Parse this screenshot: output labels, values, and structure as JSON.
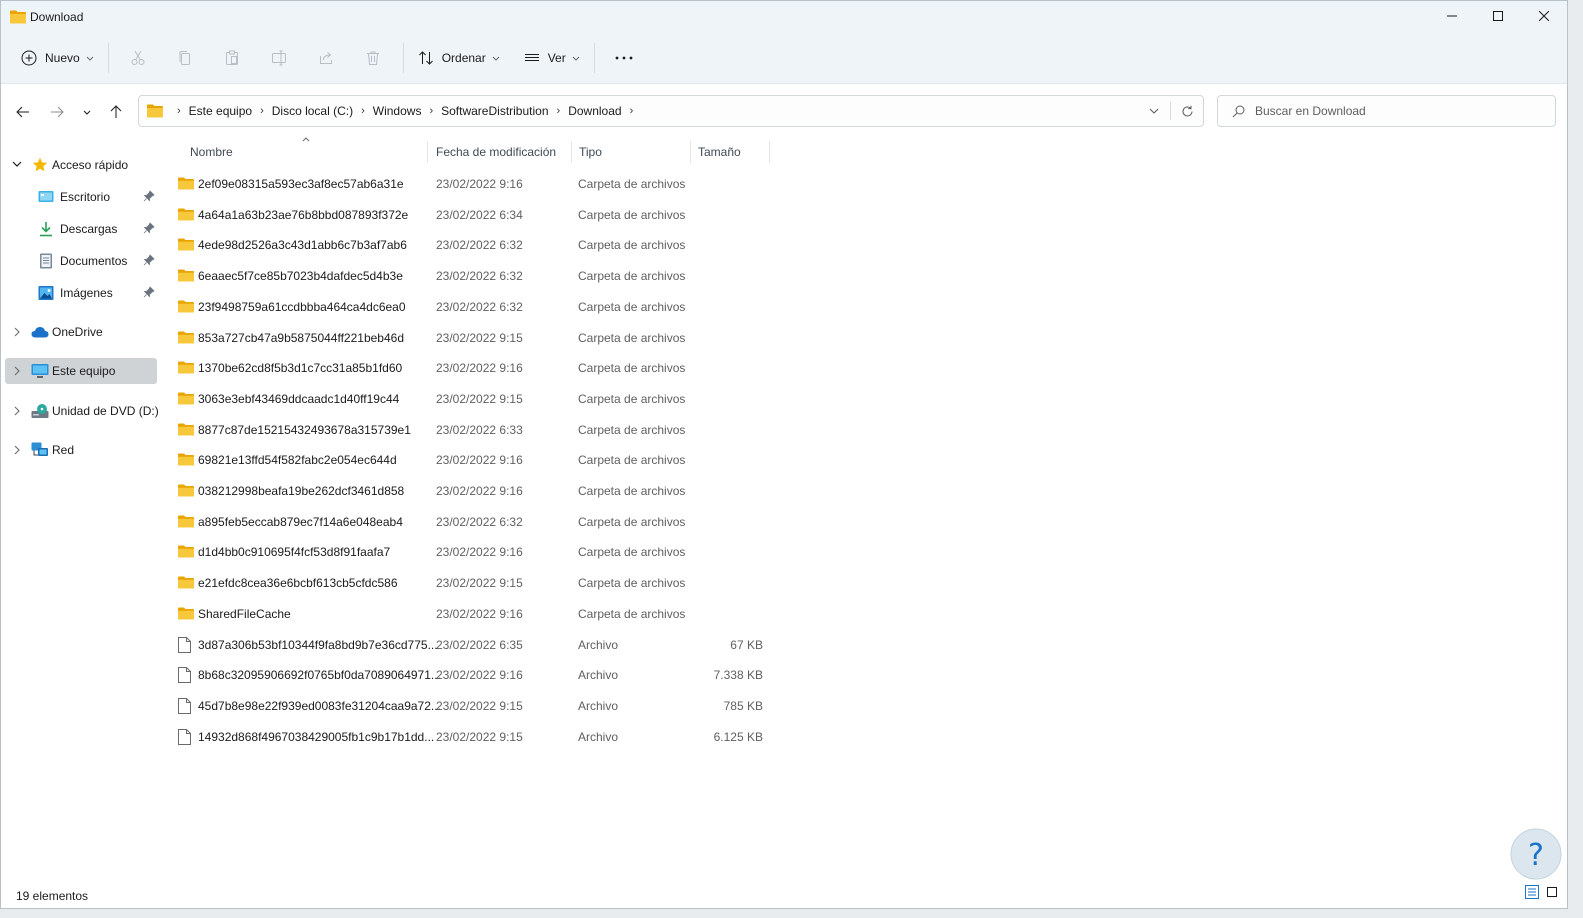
{
  "window": {
    "title": "Download",
    "controls": [
      "minimize-icon",
      "maximize-icon",
      "close-icon"
    ]
  },
  "toolbar": {
    "new_label": "Nuevo",
    "sort_label": "Ordenar",
    "view_label": "Ver",
    "icons": [
      "cut-icon",
      "copy-icon",
      "paste-icon",
      "rename-icon",
      "share-icon",
      "delete-icon",
      "more-icon"
    ]
  },
  "address": {
    "crumbs": [
      "Este equipo",
      "Disco local (C:)",
      "Windows",
      "SoftwareDistribution",
      "Download"
    ]
  },
  "search": {
    "placeholder": "Buscar en Download"
  },
  "sidebar": {
    "items": [
      {
        "label": "Acceso rápido",
        "icon": "star-icon"
      },
      {
        "label": "Escritorio",
        "icon": "desktop-icon"
      },
      {
        "label": "Descargas",
        "icon": "download-icon"
      },
      {
        "label": "Documentos",
        "icon": "documents-icon"
      },
      {
        "label": "Imágenes",
        "icon": "pictures-icon"
      },
      {
        "label": "OneDrive",
        "icon": "cloud-icon"
      },
      {
        "label": "Este equipo",
        "icon": "computer-icon"
      },
      {
        "label": "Unidad de DVD (D:)",
        "icon": "dvd-drive-icon"
      },
      {
        "label": "Red",
        "icon": "network-icon"
      }
    ]
  },
  "columns": {
    "name": "Nombre",
    "date": "Fecha de modificación",
    "type": "Tipo",
    "size": "Tamaño"
  },
  "files": [
    {
      "name": "2ef09e08315a593ec3af8ec57ab6a31e",
      "date": "23/02/2022 9:16",
      "type": "Carpeta de archivos",
      "size": "",
      "kind": "folder"
    },
    {
      "name": "4a64a1a63b23ae76b8bbd087893f372e",
      "date": "23/02/2022 6:34",
      "type": "Carpeta de archivos",
      "size": "",
      "kind": "folder"
    },
    {
      "name": "4ede98d2526a3c43d1abb6c7b3af7ab6",
      "date": "23/02/2022 6:32",
      "type": "Carpeta de archivos",
      "size": "",
      "kind": "folder"
    },
    {
      "name": "6eaaec5f7ce85b7023b4dafdec5d4b3e",
      "date": "23/02/2022 6:32",
      "type": "Carpeta de archivos",
      "size": "",
      "kind": "folder"
    },
    {
      "name": "23f9498759a61ccdbbba464ca4dc6ea0",
      "date": "23/02/2022 6:32",
      "type": "Carpeta de archivos",
      "size": "",
      "kind": "folder"
    },
    {
      "name": "853a727cb47a9b5875044ff221beb46d",
      "date": "23/02/2022 9:15",
      "type": "Carpeta de archivos",
      "size": "",
      "kind": "folder"
    },
    {
      "name": "1370be62cd8f5b3d1c7cc31a85b1fd60",
      "date": "23/02/2022 9:16",
      "type": "Carpeta de archivos",
      "size": "",
      "kind": "folder"
    },
    {
      "name": "3063e3ebf43469ddcaadc1d40ff19c44",
      "date": "23/02/2022 9:15",
      "type": "Carpeta de archivos",
      "size": "",
      "kind": "folder"
    },
    {
      "name": "8877c87de15215432493678a315739e1",
      "date": "23/02/2022 6:33",
      "type": "Carpeta de archivos",
      "size": "",
      "kind": "folder"
    },
    {
      "name": "69821e13ffd54f582fabc2e054ec644d",
      "date": "23/02/2022 9:16",
      "type": "Carpeta de archivos",
      "size": "",
      "kind": "folder"
    },
    {
      "name": "038212998beafa19be262dcf3461d858",
      "date": "23/02/2022 9:16",
      "type": "Carpeta de archivos",
      "size": "",
      "kind": "folder"
    },
    {
      "name": "a895feb5eccab879ec7f14a6e048eab4",
      "date": "23/02/2022 6:32",
      "type": "Carpeta de archivos",
      "size": "",
      "kind": "folder"
    },
    {
      "name": "d1d4bb0c910695f4fcf53d8f91faafa7",
      "date": "23/02/2022 9:16",
      "type": "Carpeta de archivos",
      "size": "",
      "kind": "folder"
    },
    {
      "name": "e21efdc8cea36e6bcbf613cb5cfdc586",
      "date": "23/02/2022 9:15",
      "type": "Carpeta de archivos",
      "size": "",
      "kind": "folder"
    },
    {
      "name": "SharedFileCache",
      "date": "23/02/2022 9:16",
      "type": "Carpeta de archivos",
      "size": "",
      "kind": "folder"
    },
    {
      "name": "3d87a306b53bf10344f9fa8bd9b7e36cd775...",
      "date": "23/02/2022 6:35",
      "type": "Archivo",
      "size": "67 KB",
      "kind": "file"
    },
    {
      "name": "8b68c32095906692f0765bf0da7089064971...",
      "date": "23/02/2022 9:16",
      "type": "Archivo",
      "size": "7.338 KB",
      "kind": "file"
    },
    {
      "name": "45d7b8e98e22f939ed0083fe31204caa9a72...",
      "date": "23/02/2022 9:15",
      "type": "Archivo",
      "size": "785 KB",
      "kind": "file"
    },
    {
      "name": "14932d868f4967038429005fb1c9b17b1dd...",
      "date": "23/02/2022 9:15",
      "type": "Archivo",
      "size": "6.125 KB",
      "kind": "file"
    }
  ],
  "status": {
    "count": "19 elementos"
  },
  "colors": {
    "folder": "#f8c83c",
    "accent": "#0067c0",
    "selected_bg": "#cfd3d6"
  }
}
